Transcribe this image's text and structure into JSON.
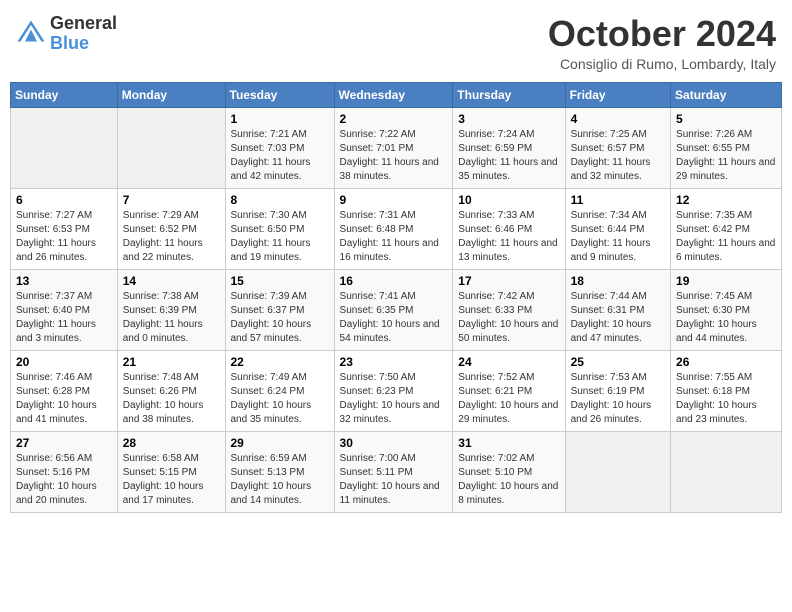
{
  "header": {
    "logo_general": "General",
    "logo_blue": "Blue",
    "month_title": "October 2024",
    "location": "Consiglio di Rumo, Lombardy, Italy"
  },
  "weekdays": [
    "Sunday",
    "Monday",
    "Tuesday",
    "Wednesday",
    "Thursday",
    "Friday",
    "Saturday"
  ],
  "weeks": [
    [
      {
        "day": "",
        "info": ""
      },
      {
        "day": "",
        "info": ""
      },
      {
        "day": "1",
        "info": "Sunrise: 7:21 AM\nSunset: 7:03 PM\nDaylight: 11 hours and 42 minutes."
      },
      {
        "day": "2",
        "info": "Sunrise: 7:22 AM\nSunset: 7:01 PM\nDaylight: 11 hours and 38 minutes."
      },
      {
        "day": "3",
        "info": "Sunrise: 7:24 AM\nSunset: 6:59 PM\nDaylight: 11 hours and 35 minutes."
      },
      {
        "day": "4",
        "info": "Sunrise: 7:25 AM\nSunset: 6:57 PM\nDaylight: 11 hours and 32 minutes."
      },
      {
        "day": "5",
        "info": "Sunrise: 7:26 AM\nSunset: 6:55 PM\nDaylight: 11 hours and 29 minutes."
      }
    ],
    [
      {
        "day": "6",
        "info": "Sunrise: 7:27 AM\nSunset: 6:53 PM\nDaylight: 11 hours and 26 minutes."
      },
      {
        "day": "7",
        "info": "Sunrise: 7:29 AM\nSunset: 6:52 PM\nDaylight: 11 hours and 22 minutes."
      },
      {
        "day": "8",
        "info": "Sunrise: 7:30 AM\nSunset: 6:50 PM\nDaylight: 11 hours and 19 minutes."
      },
      {
        "day": "9",
        "info": "Sunrise: 7:31 AM\nSunset: 6:48 PM\nDaylight: 11 hours and 16 minutes."
      },
      {
        "day": "10",
        "info": "Sunrise: 7:33 AM\nSunset: 6:46 PM\nDaylight: 11 hours and 13 minutes."
      },
      {
        "day": "11",
        "info": "Sunrise: 7:34 AM\nSunset: 6:44 PM\nDaylight: 11 hours and 9 minutes."
      },
      {
        "day": "12",
        "info": "Sunrise: 7:35 AM\nSunset: 6:42 PM\nDaylight: 11 hours and 6 minutes."
      }
    ],
    [
      {
        "day": "13",
        "info": "Sunrise: 7:37 AM\nSunset: 6:40 PM\nDaylight: 11 hours and 3 minutes."
      },
      {
        "day": "14",
        "info": "Sunrise: 7:38 AM\nSunset: 6:39 PM\nDaylight: 11 hours and 0 minutes."
      },
      {
        "day": "15",
        "info": "Sunrise: 7:39 AM\nSunset: 6:37 PM\nDaylight: 10 hours and 57 minutes."
      },
      {
        "day": "16",
        "info": "Sunrise: 7:41 AM\nSunset: 6:35 PM\nDaylight: 10 hours and 54 minutes."
      },
      {
        "day": "17",
        "info": "Sunrise: 7:42 AM\nSunset: 6:33 PM\nDaylight: 10 hours and 50 minutes."
      },
      {
        "day": "18",
        "info": "Sunrise: 7:44 AM\nSunset: 6:31 PM\nDaylight: 10 hours and 47 minutes."
      },
      {
        "day": "19",
        "info": "Sunrise: 7:45 AM\nSunset: 6:30 PM\nDaylight: 10 hours and 44 minutes."
      }
    ],
    [
      {
        "day": "20",
        "info": "Sunrise: 7:46 AM\nSunset: 6:28 PM\nDaylight: 10 hours and 41 minutes."
      },
      {
        "day": "21",
        "info": "Sunrise: 7:48 AM\nSunset: 6:26 PM\nDaylight: 10 hours and 38 minutes."
      },
      {
        "day": "22",
        "info": "Sunrise: 7:49 AM\nSunset: 6:24 PM\nDaylight: 10 hours and 35 minutes."
      },
      {
        "day": "23",
        "info": "Sunrise: 7:50 AM\nSunset: 6:23 PM\nDaylight: 10 hours and 32 minutes."
      },
      {
        "day": "24",
        "info": "Sunrise: 7:52 AM\nSunset: 6:21 PM\nDaylight: 10 hours and 29 minutes."
      },
      {
        "day": "25",
        "info": "Sunrise: 7:53 AM\nSunset: 6:19 PM\nDaylight: 10 hours and 26 minutes."
      },
      {
        "day": "26",
        "info": "Sunrise: 7:55 AM\nSunset: 6:18 PM\nDaylight: 10 hours and 23 minutes."
      }
    ],
    [
      {
        "day": "27",
        "info": "Sunrise: 6:56 AM\nSunset: 5:16 PM\nDaylight: 10 hours and 20 minutes."
      },
      {
        "day": "28",
        "info": "Sunrise: 6:58 AM\nSunset: 5:15 PM\nDaylight: 10 hours and 17 minutes."
      },
      {
        "day": "29",
        "info": "Sunrise: 6:59 AM\nSunset: 5:13 PM\nDaylight: 10 hours and 14 minutes."
      },
      {
        "day": "30",
        "info": "Sunrise: 7:00 AM\nSunset: 5:11 PM\nDaylight: 10 hours and 11 minutes."
      },
      {
        "day": "31",
        "info": "Sunrise: 7:02 AM\nSunset: 5:10 PM\nDaylight: 10 hours and 8 minutes."
      },
      {
        "day": "",
        "info": ""
      },
      {
        "day": "",
        "info": ""
      }
    ]
  ]
}
